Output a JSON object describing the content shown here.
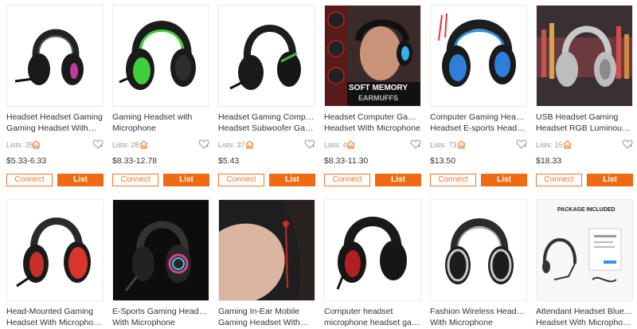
{
  "products_row1": [
    {
      "title1": "Headset Headset Gaming",
      "title2": "Gaming Headset With…",
      "lists": "Lists: 35",
      "price": "$5.33-6.33",
      "connect": "Connect",
      "list": "List"
    },
    {
      "title1": "Gaming Headset with",
      "title2": "Microphone",
      "lists": "Lists: 28",
      "price": "$8.33-12.78",
      "connect": "Connect",
      "list": "List"
    },
    {
      "title1": "Headset Gaming Computer",
      "title2": "Headset Subwoofer Gami…",
      "lists": "Lists: 37",
      "price": "$5.43",
      "connect": "Connect",
      "list": "List"
    },
    {
      "title1": "Headset Computer Gaming",
      "title2": "Headset With Microphone",
      "lists": "Lists: 4",
      "price": "$8.33-11.30",
      "connect": "Connect",
      "list": "List",
      "image_text1": "SOFT MEMORY",
      "image_text2": "EARMUFFS"
    },
    {
      "title1": "Computer Gaming Headset",
      "title2": "Headset E-sports Headset…",
      "lists": "Lists: 73",
      "price": "$13.50",
      "connect": "Connect",
      "list": "List"
    },
    {
      "title1": "USB Headset Gaming",
      "title2": "Headset RGB Luminous…",
      "lists": "Lists: 15",
      "price": "$18.33",
      "connect": "Connect",
      "list": "List"
    }
  ],
  "products_row2": [
    {
      "title1": "Head-Mounted Gaming",
      "title2": "Headset With Microphone…"
    },
    {
      "title1": "E-Sports Gaming Headset",
      "title2": "With Microphone"
    },
    {
      "title1": "Gaming In-Ear Mobile",
      "title2": "Gaming Headset With…"
    },
    {
      "title1": "Computer headset",
      "title2": "microphone headset gami…"
    },
    {
      "title1": "Fashion Wireless Headset",
      "title2": "With Microphone"
    },
    {
      "title1": "Attendant Headset Bluetooth",
      "title2": "Headset With Microphone…",
      "image_text1": "PACKAGE INCLUDED"
    }
  ],
  "colors": {
    "accent": "#f06a13",
    "connect_border": "#f3772c"
  }
}
